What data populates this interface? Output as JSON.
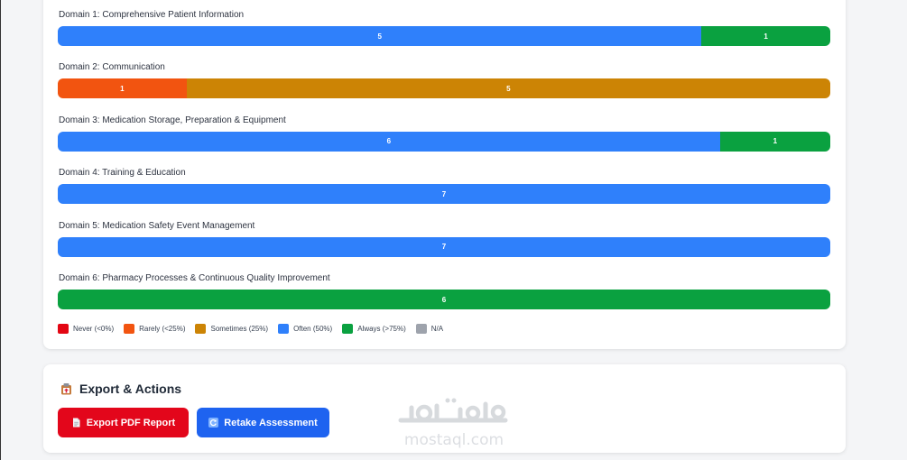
{
  "chart_data": {
    "type": "bar",
    "stacked": true,
    "orientation": "horizontal",
    "categories": [
      "Domain 1: Comprehensive Patient Information",
      "Domain 2: Communication",
      "Domain 3: Medication Storage, Preparation & Equipment",
      "Domain 4: Training & Education",
      "Domain 5: Medication Safety Event Management",
      "Domain 6: Pharmacy Processes & Continuous Quality Improvement"
    ],
    "series": [
      {
        "name": "Never (<0%)",
        "color": "#e30613",
        "values": [
          0,
          0,
          0,
          0,
          0,
          0
        ]
      },
      {
        "name": "Rarely (<25%)",
        "color": "#f25410",
        "values": [
          0,
          1,
          0,
          0,
          0,
          0
        ]
      },
      {
        "name": "Sometimes (25%)",
        "color": "#cc8405",
        "values": [
          0,
          5,
          0,
          0,
          0,
          0
        ]
      },
      {
        "name": "Often (50%)",
        "color": "#2f80fb",
        "values": [
          5,
          0,
          6,
          7,
          7,
          0
        ]
      },
      {
        "name": "Always (>75%)",
        "color": "#0aa140",
        "values": [
          1,
          0,
          1,
          0,
          0,
          6
        ]
      },
      {
        "name": "N/A",
        "color": "#9ea3ac",
        "values": [
          0,
          0,
          0,
          0,
          0,
          0
        ]
      }
    ],
    "legend": "bottom-left"
  },
  "export": {
    "title": "Export & Actions",
    "title_icon": "clipboard-icon",
    "export_label": "Export PDF Report",
    "export_icon": "document-icon",
    "retake_label": "Retake Assessment",
    "retake_icon": "refresh-icon"
  },
  "watermark": {
    "text": "mostaql.com"
  },
  "colors": {
    "export_button": "#e3061b",
    "retake_button": "#1e63f0"
  }
}
